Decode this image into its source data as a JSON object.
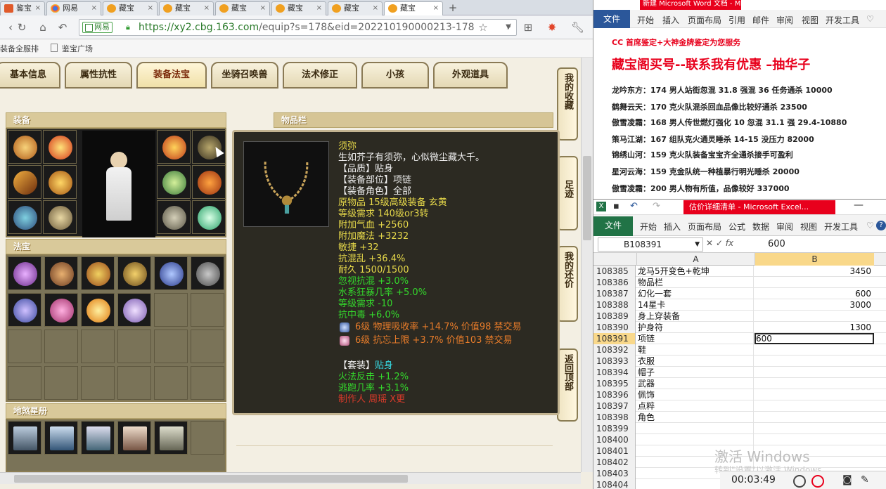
{
  "browser": {
    "tabs": [
      {
        "label": "鉴宝"
      },
      {
        "label": "网易"
      },
      {
        "label": "藏宝"
      },
      {
        "label": "藏宝"
      },
      {
        "label": "藏宝"
      },
      {
        "label": "藏宝"
      },
      {
        "label": "藏宝"
      },
      {
        "label": "藏宝"
      }
    ],
    "new_tab": "+",
    "cert_label": "网易",
    "url_main": "https://xy2.cbg.163.com",
    "url_rest": "/equip?s=178&eid=202210190000213-178",
    "bookmarks": [
      "装备全服排",
      "鉴宝广场"
    ]
  },
  "game": {
    "tabs": [
      "基本信息",
      "属性抗性",
      "装备法宝",
      "坐骑召唤兽",
      "法术修正",
      "小孩",
      "外观道具"
    ],
    "panel_equip": "装备",
    "panel_magic": "法宝",
    "panel_star": "地煞星册",
    "panel_items": "物品栏",
    "side_tabs": [
      "我的收藏",
      "足迹",
      "我的还价",
      "返回顶部"
    ],
    "tooltip": {
      "name": "须弥",
      "desc": "生如芥子有须弥，心似微尘藏大千。",
      "quality": "【品质】贴身",
      "slot": "【装备部位】项链",
      "role": "【装备角色】全部",
      "origin": "原物品 15级高级装备 玄黄",
      "req": "等级需求 140级or3转",
      "hp": "附加气血 +2560",
      "mp": "附加魔法 +3232",
      "agi": "敏捷 +32",
      "anti_chaos": "抗混乱 +36.4%",
      "durability": "耐久 1500/1500",
      "ignore_chaos": "忽视抗混 +3.0%",
      "water": "水系狂暴几率 +5.0%",
      "level_req": "等级需求 -10",
      "anti_poison": "抗中毒 +6.0%",
      "gem1": "6级 物理吸收率 +14.7% 价值98 禁交易",
      "gem2": "6级 抗忘上限 +3.7% 价值103 禁交易",
      "set_label": "【套装】",
      "set_name": "贴身",
      "set1": "火法反击 +1.2%",
      "set2": "逃跑几率 +3.1%",
      "maker": "制作人 周瑶 X更"
    }
  },
  "word": {
    "title": "新建 Microsoft Word 文档 - Mi...",
    "file": "文件",
    "tabs": [
      "开始",
      "插入",
      "页面布局",
      "引用",
      "邮件",
      "审阅",
      "视图",
      "开发工具"
    ],
    "line_top": "CC 首席鉴定+大神金牌鉴定为您服务",
    "headline": "藏宝阁买号--联系我有优惠 –抽华子",
    "lines": [
      "龙吟东方：174 男人站街忽混 31.8 强混 36 任务通杀 10000",
      "鹤舞云天：170 克火队混杀回血品像比较好通杀 23500",
      "傲雪凌霜：168 男人传世燃灯强化 10 忽混 31.1 强 29.4-10880",
      "策马江湖：167 组队克火通灵睡杀 14-15 没压力 82000",
      "锦绣山河：159 克火队装备宝宝齐全通杀接手可盈利",
      "星河云海：159 克金队统一种植暴行明光睡杀 20000",
      "傲雪凌霜：200 男人物有所值，品像较好 337000"
    ]
  },
  "excel": {
    "title": "估价详细清单 - Microsoft Excel...",
    "file": "文件",
    "tabs": [
      "开始",
      "插入",
      "页面布局",
      "公式",
      "数据",
      "审阅",
      "视图",
      "开发工具"
    ],
    "namebox": "B108391",
    "fx": "fx",
    "formula": "600",
    "col_a": "A",
    "col_b": "B",
    "rows": [
      {
        "n": "108385",
        "a": "龙马5开变色+乾坤",
        "b": "3450"
      },
      {
        "n": "108386",
        "a": "物品栏",
        "b": ""
      },
      {
        "n": "108387",
        "a": "幻化一套",
        "b": "600"
      },
      {
        "n": "108388",
        "a": "14星卡",
        "b": "3000"
      },
      {
        "n": "108389",
        "a": "身上穿装备",
        "b": ""
      },
      {
        "n": "108390",
        "a": "护身符",
        "b": "1300"
      },
      {
        "n": "108391",
        "a": "项链",
        "b": "600"
      },
      {
        "n": "108392",
        "a": "鞋",
        "b": ""
      },
      {
        "n": "108393",
        "a": "衣服",
        "b": ""
      },
      {
        "n": "108394",
        "a": "帽子",
        "b": ""
      },
      {
        "n": "108395",
        "a": "武器",
        "b": ""
      },
      {
        "n": "108396",
        "a": "佩饰",
        "b": ""
      },
      {
        "n": "108397",
        "a": "点粹",
        "b": ""
      },
      {
        "n": "108398",
        "a": "角色",
        "b": ""
      },
      {
        "n": "108399",
        "a": "",
        "b": ""
      },
      {
        "n": "108400",
        "a": "",
        "b": ""
      },
      {
        "n": "108401",
        "a": "",
        "b": ""
      },
      {
        "n": "108402",
        "a": "",
        "b": ""
      },
      {
        "n": "108403",
        "a": "",
        "b": ""
      },
      {
        "n": "108404",
        "a": "",
        "b": ""
      }
    ],
    "watermark": "激活 Windows",
    "watermark_sub": "转到\"设置\"以激活 Windows。",
    "rec_time": "00:03:49"
  },
  "colors": {
    "word_blue": "#2b579a",
    "excel_green": "#217346",
    "red": "#e8001c"
  }
}
